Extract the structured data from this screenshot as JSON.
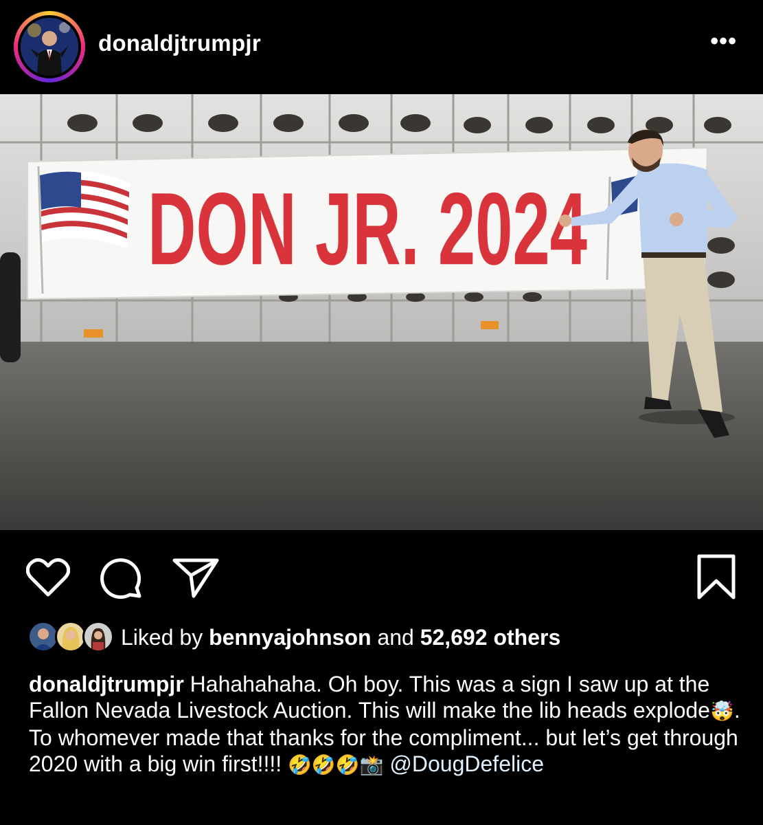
{
  "post": {
    "username": "donaldjtrumpjr",
    "more_label": "•••"
  },
  "photo": {
    "banner_text": "DON JR. 2024"
  },
  "actions": {
    "like_icon": "heart-icon",
    "comment_icon": "comment-icon",
    "share_icon": "share-icon",
    "save_icon": "bookmark-icon"
  },
  "likes": {
    "prefix": "Liked by",
    "user": "bennyajohnson",
    "middle": "and",
    "count": "52,692 others"
  },
  "caption": {
    "username": "donaldjtrumpjr",
    "text_1": "Hahahahaha. Oh boy. This was a sign I saw up at the Fallon Nevada Livestock Auction. This will make the lib heads explode",
    "emoji_1": "🤯",
    "text_2": ". To whomever made that thanks for the compliment... but let’s get through 2020 with a big win first!!!! ",
    "emoji_2": "🤣🤣🤣📸",
    "mention": "@DougDefelice"
  }
}
